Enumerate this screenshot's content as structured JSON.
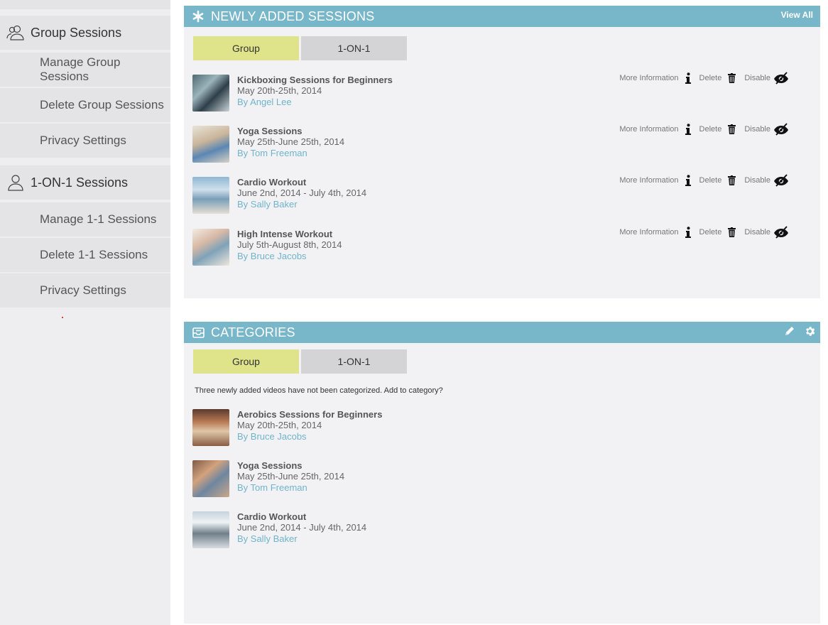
{
  "sidebar": {
    "group_header": "Group Sessions",
    "group_items": [
      "Manage Group Sessions",
      "Delete Group Sessions",
      "Privacy Settings"
    ],
    "one_header": "1-ON-1 Sessions",
    "one_items": [
      "Manage 1-1 Sessions",
      "Delete 1-1 Sessions",
      "Privacy Settings"
    ]
  },
  "new_sessions": {
    "title": "NEWLY ADDED SESSIONS",
    "view_all": "View All",
    "tabs": [
      "Group",
      "1-ON-1"
    ],
    "actions": {
      "more": "More Information",
      "delete": "Delete",
      "disable": "Disable"
    },
    "items": [
      {
        "title": "Kickboxing Sessions for Beginners",
        "date": "May 20th-25th, 2014",
        "author": "By Angel Lee"
      },
      {
        "title": "Yoga Sessions",
        "date": "May 25th-June 25th, 2014",
        "author": "By Tom Freeman"
      },
      {
        "title": "Cardio Workout",
        "date": "June 2nd, 2014 - July 4th, 2014",
        "author": "By Sally Baker"
      },
      {
        "title": "High Intense Workout",
        "date": "July 5th-August 8th, 2014",
        "author": "By Bruce Jacobs"
      }
    ]
  },
  "categories": {
    "title": "CATEGORIES",
    "tabs": [
      "Group",
      "1-ON-1"
    ],
    "notice": "Three newly added videos have not been categorized. Add to category?",
    "items": [
      {
        "title": "Aerobics Sessions for Beginners",
        "date": "May 20th-25th, 2014",
        "author": "By Bruce Jacobs"
      },
      {
        "title": "Yoga Sessions",
        "date": "May 25th-June 25th, 2014",
        "author": "By Tom Freeman"
      },
      {
        "title": "Cardio Workout",
        "date": "June 2nd, 2014 - July 4th, 2014",
        "author": "By Sally Baker"
      }
    ]
  },
  "colors": {
    "header": "#78b6c9",
    "active_tab": "#dfe48a",
    "author": "#6fb4cc"
  },
  "icons": [
    "group-icon",
    "user-icon",
    "asterisk-icon",
    "tray-icon",
    "info-icon",
    "trash-icon",
    "eye-off-icon",
    "pencil-icon",
    "gear-icon"
  ]
}
